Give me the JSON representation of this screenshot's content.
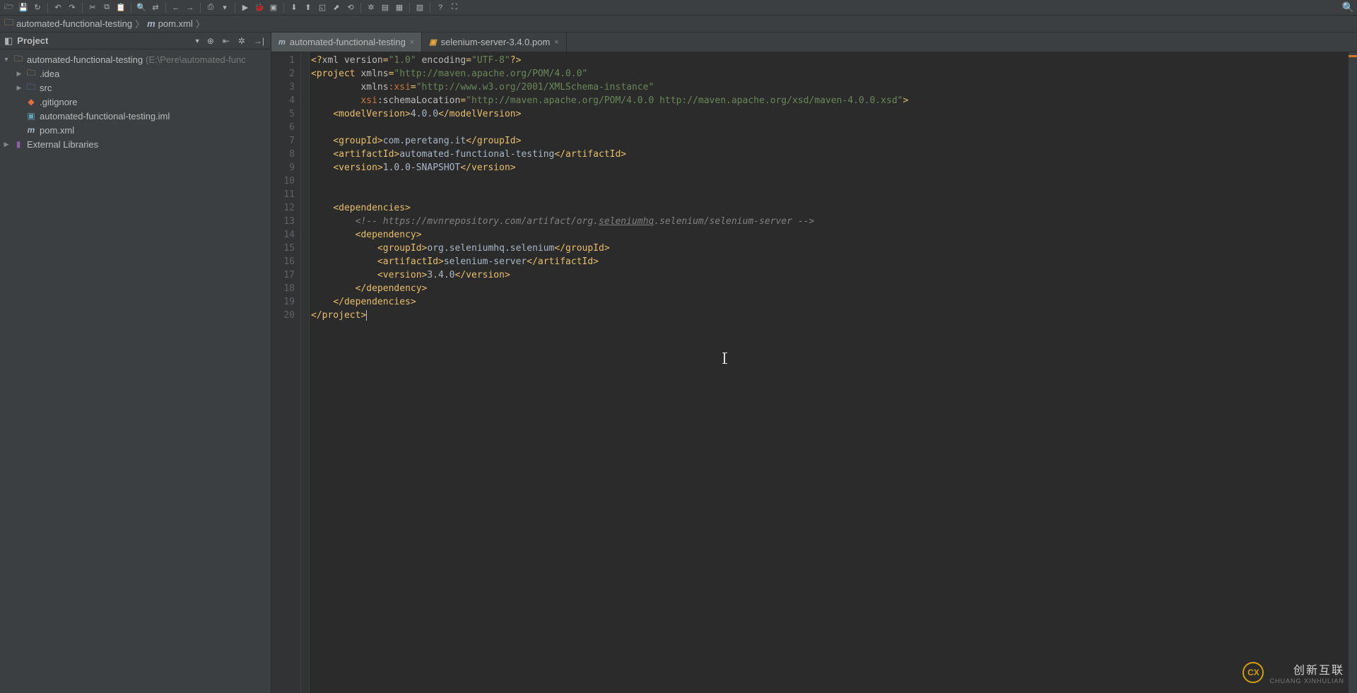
{
  "toolbar_icons": [
    "open-icon",
    "save-all-icon",
    "refresh-icon",
    "undo-icon",
    "redo-icon",
    "cut-icon",
    "copy-icon",
    "paste-icon",
    "find-icon",
    "replace-icon",
    "back-icon",
    "forward-icon",
    "build-icon",
    "run-config-icon",
    "run-icon",
    "debug-icon",
    "coverage-icon",
    "vcs-update-icon",
    "vcs-commit-icon",
    "vcs-history-icon",
    "vcs-push-icon",
    "revert-icon",
    "settings-icon",
    "structure-icon",
    "avd-icon",
    "sdk-icon",
    "help-icon",
    "expand-icon"
  ],
  "breadcrumb": {
    "project_icon": "folder",
    "project": "automated-functional-testing",
    "file_icon": "m",
    "file": "pom.xml"
  },
  "project_tool": {
    "title": "Project",
    "header_icons": [
      "target-icon",
      "collapse-icon",
      "settings-icon",
      "hide-icon"
    ]
  },
  "tree": [
    {
      "depth": 0,
      "arrow": "▼",
      "icon": "folder",
      "label": "automated-functional-testing",
      "hint": " (E:\\Pere\\automated-func"
    },
    {
      "depth": 1,
      "arrow": "▶",
      "icon": "folder",
      "label": ".idea",
      "hint": ""
    },
    {
      "depth": 1,
      "arrow": "▶",
      "icon": "src",
      "label": "src",
      "hint": ""
    },
    {
      "depth": 1,
      "arrow": "",
      "icon": "git",
      "label": ".gitignore",
      "hint": ""
    },
    {
      "depth": 1,
      "arrow": "",
      "icon": "iml",
      "label": "automated-functional-testing.iml",
      "hint": ""
    },
    {
      "depth": 1,
      "arrow": "",
      "icon": "m",
      "label": "pom.xml",
      "hint": ""
    },
    {
      "depth": 0,
      "arrow": "▶",
      "icon": "lib",
      "label": "External Libraries",
      "hint": ""
    }
  ],
  "tabs": [
    {
      "icon": "m",
      "label": "automated-functional-testing",
      "active": true
    },
    {
      "icon": "jar",
      "label": "selenium-server-3.4.0.pom",
      "active": false
    }
  ],
  "code_lines": [
    [
      {
        "c": "t-tag",
        "t": "<?"
      },
      {
        "c": "t-attr",
        "t": "xml version"
      },
      {
        "c": "t-tag",
        "t": "="
      },
      {
        "c": "t-str",
        "t": "\"1.0\""
      },
      {
        "c": "t-attr",
        "t": " encoding"
      },
      {
        "c": "t-tag",
        "t": "="
      },
      {
        "c": "t-str",
        "t": "\"UTF-8\""
      },
      {
        "c": "t-tag",
        "t": "?>"
      }
    ],
    [
      {
        "c": "t-tag",
        "t": "<project "
      },
      {
        "c": "t-attr",
        "t": "xmlns"
      },
      {
        "c": "t-tag",
        "t": "="
      },
      {
        "c": "t-str",
        "t": "\"http://maven.apache.org/POM/4.0.0\""
      }
    ],
    [
      {
        "c": "",
        "t": "         "
      },
      {
        "c": "t-attr",
        "t": "xmlns"
      },
      {
        "c": "t-ns",
        "t": ":xsi"
      },
      {
        "c": "t-tag",
        "t": "="
      },
      {
        "c": "t-str",
        "t": "\"http://www.w3.org/2001/XMLSchema-instance\""
      }
    ],
    [
      {
        "c": "",
        "t": "         "
      },
      {
        "c": "t-ns",
        "t": "xsi"
      },
      {
        "c": "t-attr",
        "t": ":schemaLocation"
      },
      {
        "c": "t-tag",
        "t": "="
      },
      {
        "c": "t-str",
        "t": "\"http://maven.apache.org/POM/4.0.0 http://maven.apache.org/xsd/maven-4.0.0.xsd\""
      },
      {
        "c": "t-tag",
        "t": ">"
      }
    ],
    [
      {
        "c": "",
        "t": "    "
      },
      {
        "c": "t-tag",
        "t": "<modelVersion>"
      },
      {
        "c": "t-text",
        "t": "4.0.0"
      },
      {
        "c": "t-tag",
        "t": "</modelVersion>"
      }
    ],
    [],
    [
      {
        "c": "",
        "t": "    "
      },
      {
        "c": "t-tag",
        "t": "<groupId>"
      },
      {
        "c": "t-text",
        "t": "com.peretang.it"
      },
      {
        "c": "t-tag",
        "t": "</groupId>"
      }
    ],
    [
      {
        "c": "",
        "t": "    "
      },
      {
        "c": "t-tag",
        "t": "<artifactId>"
      },
      {
        "c": "t-text",
        "t": "automated-functional-testing"
      },
      {
        "c": "t-tag",
        "t": "</artifactId>"
      }
    ],
    [
      {
        "c": "",
        "t": "    "
      },
      {
        "c": "t-tag",
        "t": "<version>"
      },
      {
        "c": "t-text",
        "t": "1.0.0-SNAPSHOT"
      },
      {
        "c": "t-tag",
        "t": "</version>"
      }
    ],
    [],
    [],
    [
      {
        "c": "",
        "t": "    "
      },
      {
        "c": "t-tag",
        "t": "<dependencies>"
      }
    ],
    [
      {
        "c": "",
        "t": "        "
      },
      {
        "c": "t-cmt",
        "t": "<!-- https://mvnrepository.com/artifact/org."
      },
      {
        "c": "t-cmt-u",
        "t": "seleniumhq"
      },
      {
        "c": "t-cmt",
        "t": ".selenium/selenium-server -->"
      }
    ],
    [
      {
        "c": "",
        "t": "        "
      },
      {
        "c": "t-tag",
        "t": "<dependency>"
      }
    ],
    [
      {
        "c": "",
        "t": "            "
      },
      {
        "c": "t-tag",
        "t": "<groupId>"
      },
      {
        "c": "t-text",
        "t": "org.seleniumhq.selenium"
      },
      {
        "c": "t-tag",
        "t": "</groupId>"
      }
    ],
    [
      {
        "c": "",
        "t": "            "
      },
      {
        "c": "t-tag",
        "t": "<artifactId>"
      },
      {
        "c": "t-text",
        "t": "selenium-server"
      },
      {
        "c": "t-tag",
        "t": "</artifactId>"
      }
    ],
    [
      {
        "c": "",
        "t": "            "
      },
      {
        "c": "t-tag",
        "t": "<version>"
      },
      {
        "c": "t-text",
        "t": "3.4.0"
      },
      {
        "c": "t-tag",
        "t": "</version>"
      }
    ],
    [
      {
        "c": "",
        "t": "        "
      },
      {
        "c": "t-tag",
        "t": "</dependency>"
      }
    ],
    [
      {
        "c": "",
        "t": "    "
      },
      {
        "c": "t-tag",
        "t": "</dependencies>"
      }
    ],
    [
      {
        "c": "t-tag",
        "t": "</project>"
      }
    ]
  ],
  "line_count": 20,
  "watermark": {
    "cn": "创新互联",
    "en": "CHUANG XINHULIAN",
    "logo": "CX"
  }
}
